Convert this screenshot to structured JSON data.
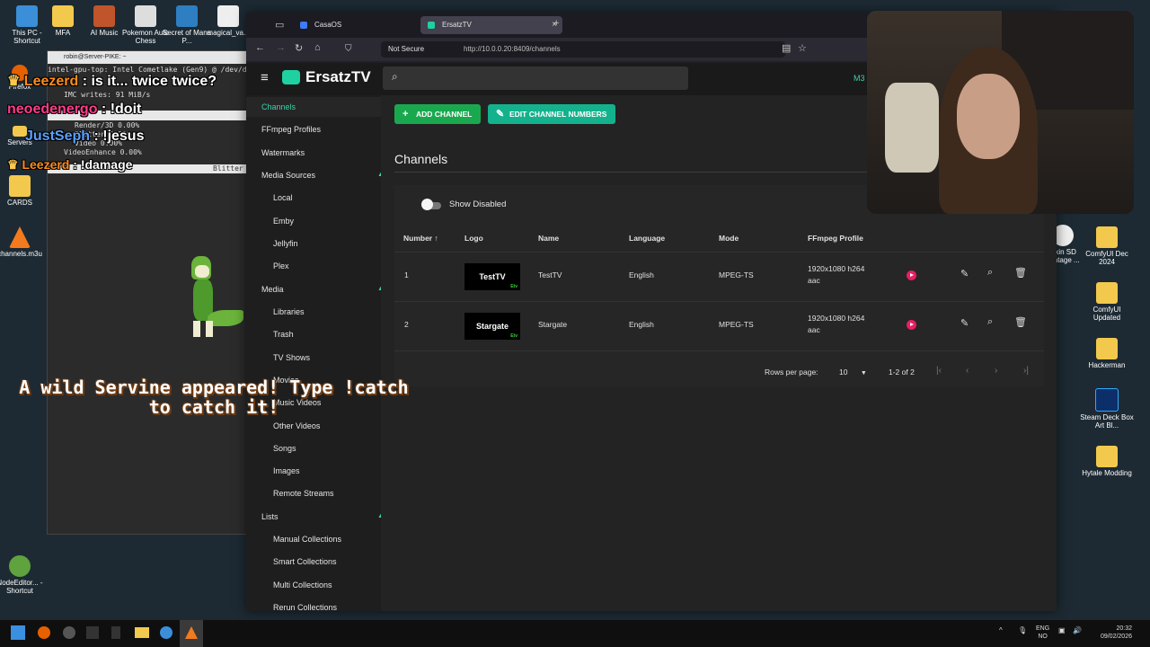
{
  "desktop": {
    "icons_left": [
      {
        "label": "This PC - Shortcut",
        "icon": "computer-icon"
      },
      {
        "label": "MFA",
        "icon": "folder-icon"
      },
      {
        "label": "AI Music",
        "icon": "app-icon"
      },
      {
        "label": "Pokemon Auto Chess",
        "icon": "app-icon"
      },
      {
        "label": "Secret of Mana P...",
        "icon": "app-icon"
      },
      {
        "label": "magical_va...",
        "icon": "file-icon"
      },
      {
        "label": "Firefox",
        "icon": "firefox-icon"
      },
      {
        "label": "Servers",
        "icon": "folder-icon"
      },
      {
        "label": "CARDS",
        "icon": "folder-icon"
      },
      {
        "label": "channels.m3u",
        "icon": "vlc-icon"
      },
      {
        "label": "NodeEditor... - Shortcut",
        "icon": "app-icon"
      }
    ],
    "icons_right": [
      {
        "label": "ComfyUI Dec 2024",
        "icon": "folder-icon"
      },
      {
        "label": "ComfyUI Updated",
        "icon": "folder-icon"
      },
      {
        "label": "Hackerman",
        "icon": "folder-icon"
      },
      {
        "label": "Steam Deck Box Art Bl...",
        "icon": "photoshop-icon"
      },
      {
        "label": "Hytale Modding",
        "icon": "folder-icon"
      },
      {
        "label": "elkin SD vantage ...",
        "icon": "app-icon"
      }
    ]
  },
  "terminal": {
    "title": "robin@Server-PIKE: ~",
    "line1": "intel-gpu-top: Intel Cometlake (Gen9) @ /dev/dri/c",
    "line2": "IMC writes:       91 MiB/s",
    "rows": [
      "Render/3D    0.00%",
      "Blitter    0.00%",
      "Video    0.00%",
      "VideoEnhance    0.00%"
    ],
    "blitter": "Blitter"
  },
  "overlay": {
    "chat": [
      {
        "user": "Leezerd",
        "msg": "is it... twice twice?",
        "color": "#ff8c1a"
      },
      {
        "user": "neoedenergo",
        "msg": "!doit",
        "color": "#ff3c8c"
      },
      {
        "user": "JustSeph",
        "msg": "!jesus",
        "color": "#5aa0ff"
      },
      {
        "user": "Leezerd",
        "msg": "!damage",
        "color": "#ff8c1a"
      }
    ],
    "poke_message": "A wild Servine appeared! Type !catch to catch it!"
  },
  "browser": {
    "tabs": [
      {
        "label": "CasaOS",
        "active": false
      },
      {
        "label": "ErsatzTV",
        "active": true
      }
    ],
    "security": "Not Secure",
    "url": "http://10.0.0.20:8409/channels"
  },
  "app": {
    "brand": "ErsatzTV",
    "header_right": "M3",
    "sidebar": {
      "items": [
        {
          "label": "Channels",
          "level": 1,
          "selected": true
        },
        {
          "label": "FFmpeg Profiles",
          "level": 1
        },
        {
          "label": "Watermarks",
          "level": 1
        },
        {
          "label": "Media Sources",
          "level": 1,
          "expanded": true
        },
        {
          "label": "Local",
          "level": 2
        },
        {
          "label": "Emby",
          "level": 2
        },
        {
          "label": "Jellyfin",
          "level": 2
        },
        {
          "label": "Plex",
          "level": 2
        },
        {
          "label": "Media",
          "level": 1,
          "expanded": true
        },
        {
          "label": "Libraries",
          "level": 2
        },
        {
          "label": "Trash",
          "level": 2
        },
        {
          "label": "TV Shows",
          "level": 2
        },
        {
          "label": "Movies",
          "level": 2
        },
        {
          "label": "Music Videos",
          "level": 2
        },
        {
          "label": "Other Videos",
          "level": 2
        },
        {
          "label": "Songs",
          "level": 2
        },
        {
          "label": "Images",
          "level": 2
        },
        {
          "label": "Remote Streams",
          "level": 2
        },
        {
          "label": "Lists",
          "level": 1,
          "expanded": true
        },
        {
          "label": "Manual Collections",
          "level": 2
        },
        {
          "label": "Smart Collections",
          "level": 2
        },
        {
          "label": "Multi Collections",
          "level": 2
        },
        {
          "label": "Rerun Collections",
          "level": 2
        }
      ]
    },
    "toolbar": {
      "add_label": "ADD CHANNEL",
      "edit_label": "EDIT CHANNEL NUMBERS"
    },
    "page_title": "Channels",
    "show_disabled_label": "Show Disabled",
    "show_disabled": false,
    "table": {
      "columns": [
        "Number",
        "Logo",
        "Name",
        "Language",
        "Mode",
        "FFmpeg Profile"
      ],
      "rows": [
        {
          "number": "1",
          "logo": "TestTV",
          "name": "TestTV",
          "language": "English",
          "mode": "MPEG-TS",
          "profile1": "1920x1080 h264",
          "profile2": "aac"
        },
        {
          "number": "2",
          "logo": "Stargate",
          "name": "Stargate",
          "language": "English",
          "mode": "MPEG-TS",
          "profile1": "1920x1080 h264",
          "profile2": "aac"
        }
      ],
      "logo_badge": "Etv"
    },
    "pagination": {
      "rows_per_page_label": "Rows per page:",
      "rows_per_page": "10",
      "range": "1-2 of 2"
    }
  },
  "taskbar": {
    "lang1": "ENG",
    "lang2": "NO",
    "time": "20:32",
    "date": "09/02/2026"
  },
  "colors": {
    "accent": "#3bd3a9",
    "add_button": "#1aa84f",
    "edit_button": "#13b28d",
    "play": "#e91e63"
  }
}
